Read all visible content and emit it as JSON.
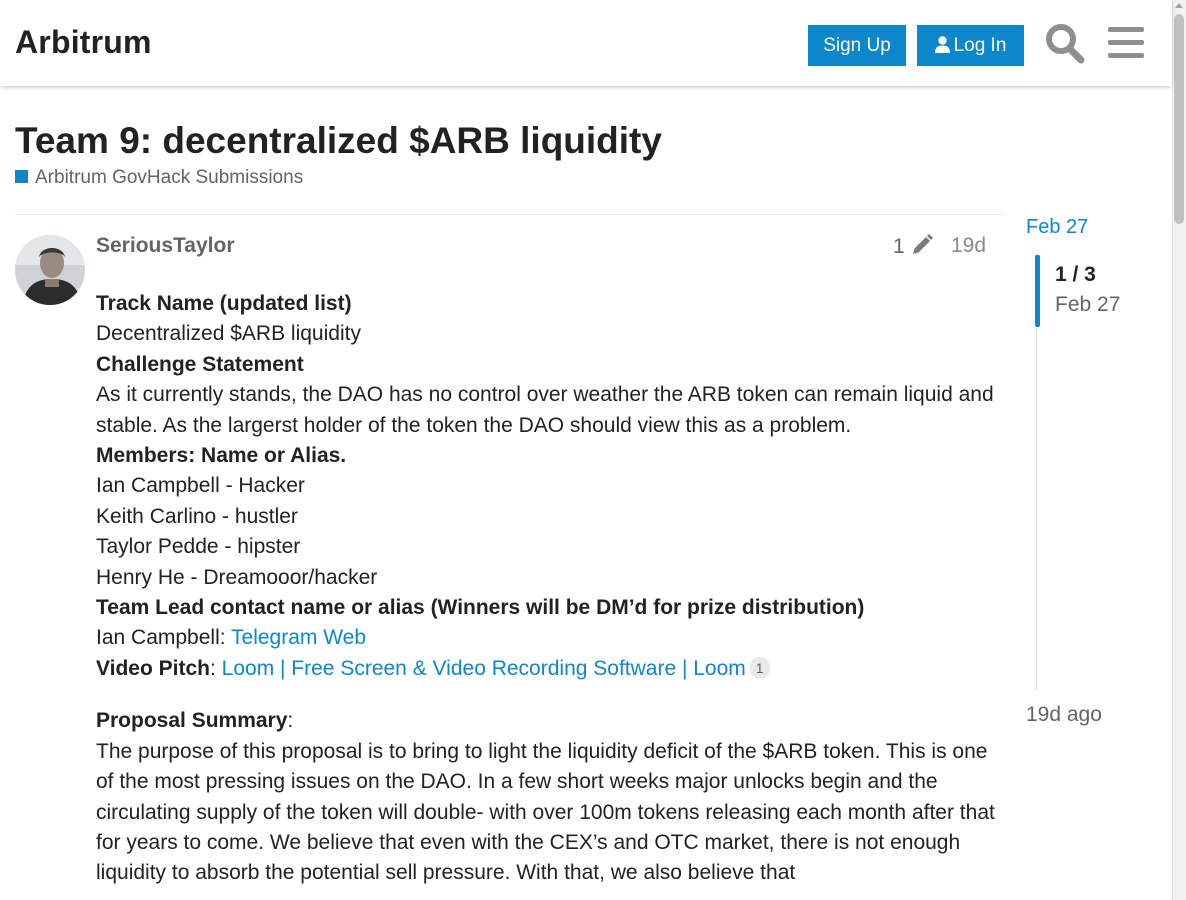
{
  "header": {
    "site_title": "Arbitrum",
    "signup_label": "Sign Up",
    "login_label": "Log In"
  },
  "topic": {
    "title": "Team 9: decentralized $ARB liquidity",
    "category": "Arbitrum GovHack Submissions",
    "category_color": "#0C87CC"
  },
  "post": {
    "username": "SeriousTaylor",
    "edit_count": "1",
    "age": "19d",
    "lines": [
      {
        "kind": "bold",
        "text": "Track Name (updated list)"
      },
      {
        "kind": "text",
        "text": "Decentralized $ARB liquidity"
      },
      {
        "kind": "bold",
        "text": "Challenge Statement"
      },
      {
        "kind": "text",
        "text": "As it currently stands, the DAO has no control over weather the ARB token can remain liquid and stable. As the largerst holder of the token the DAO should view this as a problem."
      },
      {
        "kind": "bold",
        "text": "Members: Name or Alias."
      },
      {
        "kind": "text",
        "text": "Ian Campbell - Hacker"
      },
      {
        "kind": "text",
        "text": "Keith Carlino - hustler"
      },
      {
        "kind": "text",
        "text": "Taylor Pedde - hipster"
      },
      {
        "kind": "text",
        "text": "Henry He - Dreamooor/hacker"
      },
      {
        "kind": "bold",
        "text": "Team Lead contact name or alias (Winners will be DM’d for prize distribution)"
      }
    ],
    "team_lead": {
      "prefix": "Ian Campbell: ",
      "link": "Telegram Web"
    },
    "video_pitch": {
      "label": "Video Pitch",
      "sep": ": ",
      "link": "Loom | Free Screen & Video Recording Software | Loom",
      "clicks": "1"
    },
    "proposal": {
      "label": "Proposal Summary",
      "sep": ":",
      "text": "The purpose of this proposal is to bring to light the liquidity deficit of the $ARB token. This is one of the most pressing issues on the DAO. In a few short weeks major unlocks begin and the circulating supply of the token will double- with over 100m tokens releasing each month after that for years to come. We believe that even with the CEX’s and OTC market, there is not enough liquidity to absorb the potential sell pressure. With that, we also believe that"
    }
  },
  "timeline": {
    "start_date": "Feb 27",
    "position": "1 / 3",
    "position_date": "Feb 27",
    "end_label": "19d ago"
  }
}
